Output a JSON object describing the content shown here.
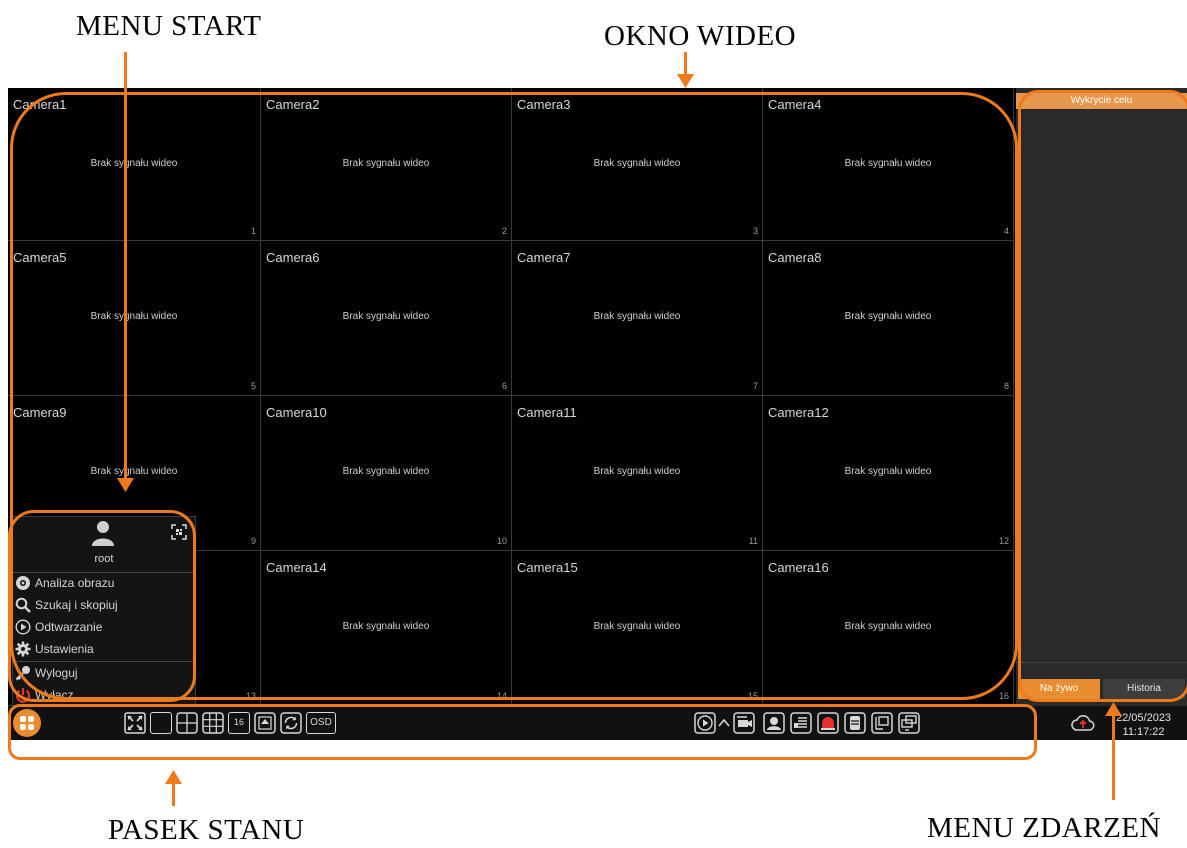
{
  "annotations": {
    "menu_start": "MENU START",
    "okno_wideo": "OKNO WIDEO",
    "pasek_stanu": "PASEK STANU",
    "menu_zdarzen": "MENU ZDARZEŃ"
  },
  "cameras": [
    {
      "name": "Camera1",
      "status": "Brak sygnału wideo",
      "number": "1"
    },
    {
      "name": "Camera2",
      "status": "Brak sygnału wideo",
      "number": "2"
    },
    {
      "name": "Camera3",
      "status": "Brak sygnału wideo",
      "number": "3"
    },
    {
      "name": "Camera4",
      "status": "Brak sygnału wideo",
      "number": "4"
    },
    {
      "name": "Camera5",
      "status": "Brak sygnału wideo",
      "number": "5"
    },
    {
      "name": "Camera6",
      "status": "Brak sygnału wideo",
      "number": "6"
    },
    {
      "name": "Camera7",
      "status": "Brak sygnału wideo",
      "number": "7"
    },
    {
      "name": "Camera8",
      "status": "Brak sygnału wideo",
      "number": "8"
    },
    {
      "name": "Camera9",
      "status": "Brak sygnału wideo",
      "number": "9"
    },
    {
      "name": "Camera10",
      "status": "Brak sygnału wideo",
      "number": "10"
    },
    {
      "name": "Camera11",
      "status": "Brak sygnału wideo",
      "number": "11"
    },
    {
      "name": "Camera12",
      "status": "Brak sygnału wideo",
      "number": "12"
    },
    {
      "name": "",
      "status": "",
      "number": "13"
    },
    {
      "name": "Camera14",
      "status": "Brak sygnału wideo",
      "number": "14"
    },
    {
      "name": "Camera15",
      "status": "Brak sygnału wideo",
      "number": "15"
    },
    {
      "name": "Camera16",
      "status": "Brak sygnału wideo",
      "number": "16"
    }
  ],
  "start_menu": {
    "user": "root",
    "items": [
      {
        "label": "Analiza obrazu",
        "icon": "analysis-icon"
      },
      {
        "label": "Szukaj i skopiuj",
        "icon": "search-icon"
      },
      {
        "label": "Odtwarzanie",
        "icon": "play-icon"
      },
      {
        "label": "Ustawienia",
        "icon": "gear-icon"
      },
      {
        "label": "Wyloguj",
        "icon": "key-icon"
      },
      {
        "label": "Wyłącz",
        "icon": "power-icon"
      }
    ]
  },
  "events_panel": {
    "title": "Wykrycie celu",
    "tabs": [
      "Na żywo",
      "Historia"
    ]
  },
  "status_bar": {
    "osd_label": "OSD",
    "layout_16_label": "16",
    "date": "22/05/2023",
    "time": "11:17:22",
    "icons": [
      "start-menu-icon",
      "fullscreen-icon",
      "layout-1-icon",
      "layout-4-icon",
      "layout-9-icon",
      "layout-16-icon",
      "picture-in-picture-icon",
      "sequence-icon",
      "play-icon",
      "chevron-up-icon",
      "manual-record-icon",
      "face-icon",
      "snapshot-icon",
      "alarm-icon",
      "disk-icon",
      "network-icon",
      "display-icon",
      "cloud-upload-icon"
    ]
  },
  "colors": {
    "accent": "#e98c30",
    "annotation": "#ef7a1a",
    "background": "#000000"
  }
}
